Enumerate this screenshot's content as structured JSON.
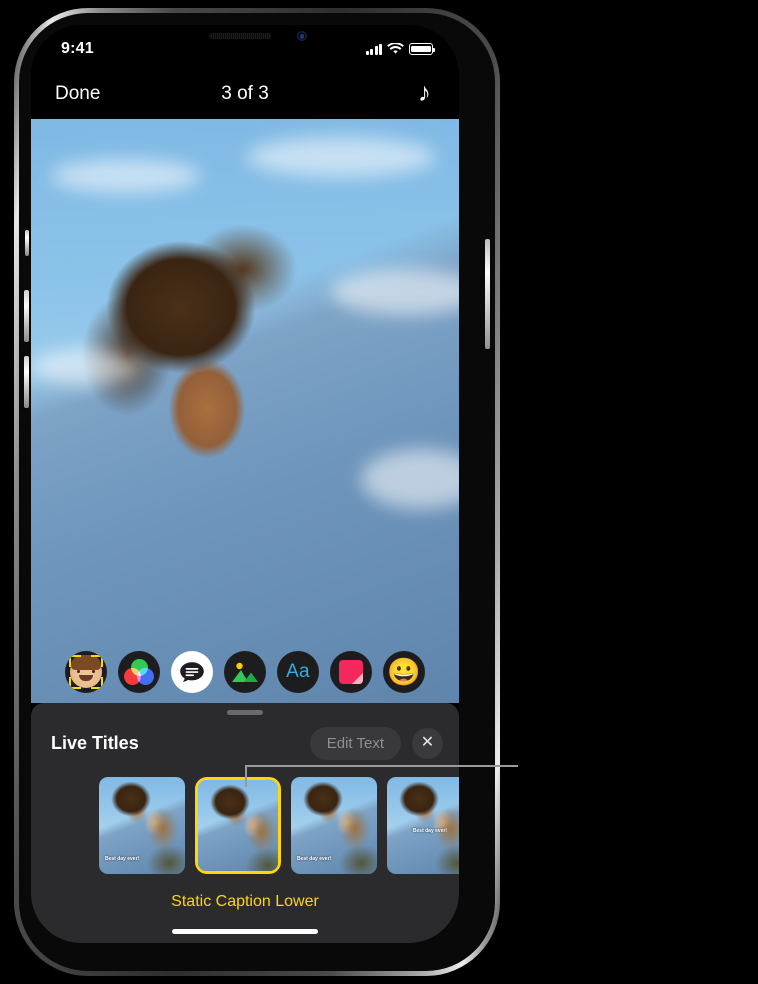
{
  "status_bar": {
    "time": "9:41",
    "cellular_icon": "cellular-signal-icon",
    "wifi_icon": "wifi-icon",
    "battery_icon": "battery-icon"
  },
  "nav_bar": {
    "done_label": "Done",
    "title": "3 of 3",
    "music_icon": "♪"
  },
  "effects_toolbar": {
    "items": [
      {
        "name": "memoji",
        "icon": "memoji-icon",
        "active": false
      },
      {
        "name": "filters",
        "icon": "filters-icon",
        "active": false
      },
      {
        "name": "live-titles",
        "icon": "message-bubble-icon",
        "active": true
      },
      {
        "name": "photos",
        "icon": "photo-landscape-icon",
        "active": false
      },
      {
        "name": "text",
        "icon": "aa-text-icon",
        "label": "Aa",
        "active": false
      },
      {
        "name": "stickers",
        "icon": "sticker-icon",
        "active": false
      },
      {
        "name": "emoji",
        "icon": "emoji-icon",
        "label": "😀",
        "active": false
      }
    ]
  },
  "live_titles_sheet": {
    "title": "Live Titles",
    "edit_text_label": "Edit Text",
    "close_icon": "✕",
    "selected_style_name": "Static Caption Lower",
    "styles": [
      {
        "label": "",
        "selected": false,
        "caption_preview": "Best day ever!",
        "caption_position": "lower"
      },
      {
        "label": "Static Caption Lower",
        "selected": true,
        "caption_preview": "",
        "caption_position": "lower"
      },
      {
        "label": "",
        "selected": false,
        "caption_preview": "Best day ever!",
        "caption_position": "lower"
      },
      {
        "label": "",
        "selected": false,
        "caption_preview": "Best day ever!",
        "caption_position": "center"
      }
    ]
  },
  "colors": {
    "accent_yellow": "#ffd60a",
    "sheet_background": "#2b2b2d",
    "text_blue": "#32ade6",
    "sticker_pink": "#f5275f",
    "callout_line": "#9a9a9a"
  }
}
